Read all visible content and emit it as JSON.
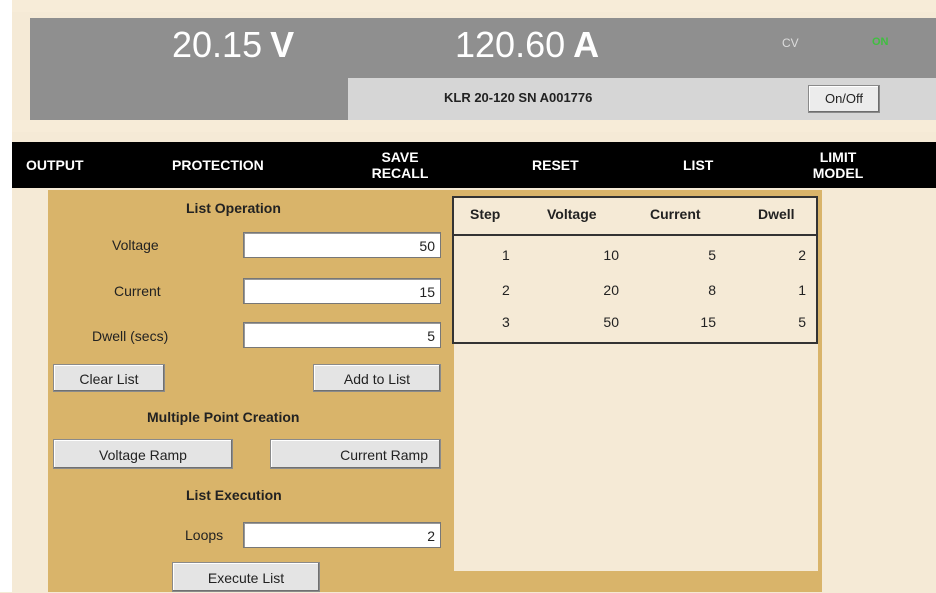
{
  "status": {
    "voltage_value": "20.15",
    "voltage_unit": "V",
    "current_value": "120.60",
    "current_unit": "A",
    "mode": "CV",
    "output_state": "ON",
    "model": "KLR 20-120 SN A001776",
    "onoff_label": "On/Off"
  },
  "nav": {
    "output": "OUTPUT",
    "protection": "PROTECTION",
    "save": "SAVE",
    "recall": "RECALL",
    "reset": "RESET",
    "list": "LIST",
    "limit": "LIMIT",
    "model": "MODEL"
  },
  "list_operation": {
    "title": "List Operation",
    "voltage_label": "Voltage",
    "voltage_value": "50",
    "current_label": "Current",
    "current_value": "15",
    "dwell_label": "Dwell (secs)",
    "dwell_value": "5",
    "clear_label": "Clear List",
    "add_label": "Add to List"
  },
  "multiple_point": {
    "title": "Multiple Point Creation",
    "voltage_ramp_label": "Voltage Ramp",
    "current_ramp_label": "Current Ramp"
  },
  "list_execution": {
    "title": "List Execution",
    "loops_label": "Loops",
    "loops_value": "2",
    "execute_label": "Execute List"
  },
  "table": {
    "headers": {
      "step": "Step",
      "voltage": "Voltage",
      "current": "Current",
      "dwell": "Dwell"
    },
    "rows": [
      {
        "step": "1",
        "voltage": "10",
        "current": "5",
        "dwell": "2"
      },
      {
        "step": "2",
        "voltage": "20",
        "current": "8",
        "dwell": "1"
      },
      {
        "step": "3",
        "voltage": "50",
        "current": "15",
        "dwell": "5"
      }
    ]
  },
  "colors": {
    "panel": "#d9b46a",
    "background": "#f5ead6",
    "header_gray": "#8f8f8f",
    "on_green": "#3fbf3f"
  }
}
